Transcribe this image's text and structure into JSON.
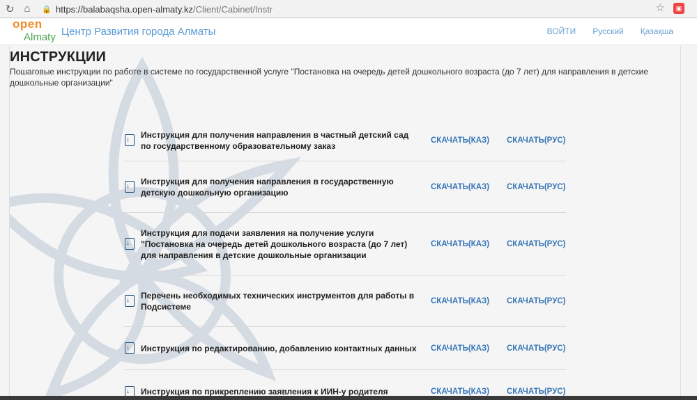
{
  "browser": {
    "url_host": "https://balabaqsha.open-almaty.kz",
    "url_path": "/Client/Cabinet/Instr"
  },
  "header": {
    "logo_open": "open",
    "logo_almaty": "Almaty",
    "site_title": "Центр Развития города Алматы",
    "nav": [
      "ВОЙТИ",
      "Русский",
      "Қазақша"
    ]
  },
  "page": {
    "title": "ИНСТРУКЦИИ",
    "description": "Пошаговые инструкции по работе в системе по государственной услуге \"Постановка на очередь детей дошкольного возраста (до 7 лет) для направления в детские дошкольные организации\""
  },
  "download_labels": {
    "kaz": "СКАЧАТЬ(КАЗ)",
    "rus": "СКАЧАТЬ(РУС)"
  },
  "instructions": [
    "Инструкция для получения направления в частный детский сад по государственному образовательному заказ",
    "Инструкция для получения направления в государственную детскую дошкольную организацию",
    "Инструкция для подачи заявления на получение услуги \"Постановка на очередь детей дошкольного возраста (до 7 лет) для направления в детские дошкольные организации",
    "Перечень необходимых технических инструментов для работы в Подсистеме",
    "Инструкция по редактированию, добавлению контактных данных",
    "Инструкция по прикреплению заявления к ИИН-у родителя"
  ],
  "colors": {
    "link": "#3776b8",
    "brand": "#5b9bd5",
    "icon": "#1f4e79"
  }
}
